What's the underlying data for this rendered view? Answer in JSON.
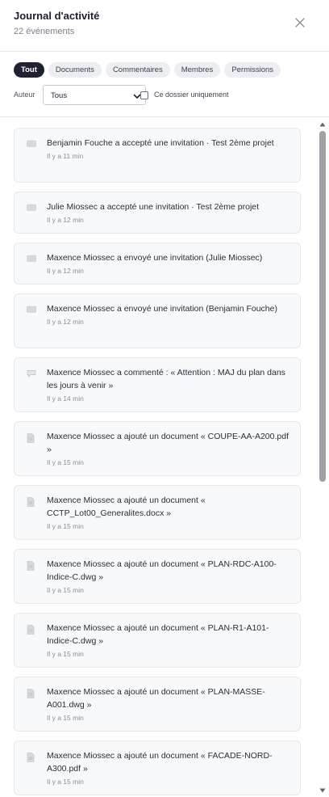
{
  "header": {
    "title": "Journal d'activité",
    "subtitle": "22 événements",
    "close_icon": "close-icon"
  },
  "filters": [
    {
      "label": "Tout",
      "active": true
    },
    {
      "label": "Documents",
      "active": false
    },
    {
      "label": "Commentaires",
      "active": false
    },
    {
      "label": "Membres",
      "active": false
    },
    {
      "label": "Permissions",
      "active": false
    }
  ],
  "author": {
    "label": "Auteur",
    "selected": "Tous",
    "checkbox_label": "Ce dossier uniquement",
    "checkbox_checked": false
  },
  "events": [
    {
      "icon": "folder-icon",
      "text": "Benjamin Fouche a accepté une invitation · Test 2ème projet",
      "time": "Il y a 11 min"
    },
    {
      "icon": "folder-icon",
      "text": "Julie Miossec a accepté une invitation · Test 2ème projet",
      "time": "Il y a 12 min"
    },
    {
      "icon": "folder-icon",
      "text": "Maxence Miossec a envoyé une invitation (Julie Miossec)",
      "time": "Il y a 12 min"
    },
    {
      "icon": "folder-icon",
      "text": "Maxence Miossec a envoyé une invitation (Benjamin Fouche)",
      "time": "Il y a 12 min"
    },
    {
      "icon": "comment-icon",
      "text": "Maxence Miossec a commenté : « Attention : MAJ du plan dans les jours à venir »",
      "time": "Il y a 14 min"
    },
    {
      "icon": "document-icon",
      "text": "Maxence Miossec a ajouté un document « COUPE-AA-A200.pdf »",
      "time": "Il y a 15 min"
    },
    {
      "icon": "document-icon",
      "text": "Maxence Miossec a ajouté un document « CCTP_Lot00_Generalites.docx »",
      "time": "Il y a 15 min"
    },
    {
      "icon": "document-icon",
      "text": "Maxence Miossec a ajouté un document « PLAN-RDC-A100-Indice-C.dwg »",
      "time": "Il y a 15 min"
    },
    {
      "icon": "document-icon",
      "text": "Maxence Miossec a ajouté un document « PLAN-R1-A101-Indice-C.dwg »",
      "time": "Il y a 15 min"
    },
    {
      "icon": "document-icon",
      "text": "Maxence Miossec a ajouté un document « PLAN-MASSE-A001.dwg »",
      "time": "Il y a 15 min"
    },
    {
      "icon": "document-icon",
      "text": "Maxence Miossec a ajouté un document « FACADE-NORD-A300.pdf »",
      "time": "Il y a 15 min"
    }
  ],
  "colors": {
    "active_chip": "#1f2230",
    "chip": "#eceef1",
    "card_bg": "#f8f9fa",
    "scroll_thumb": "#9ea1a6"
  }
}
